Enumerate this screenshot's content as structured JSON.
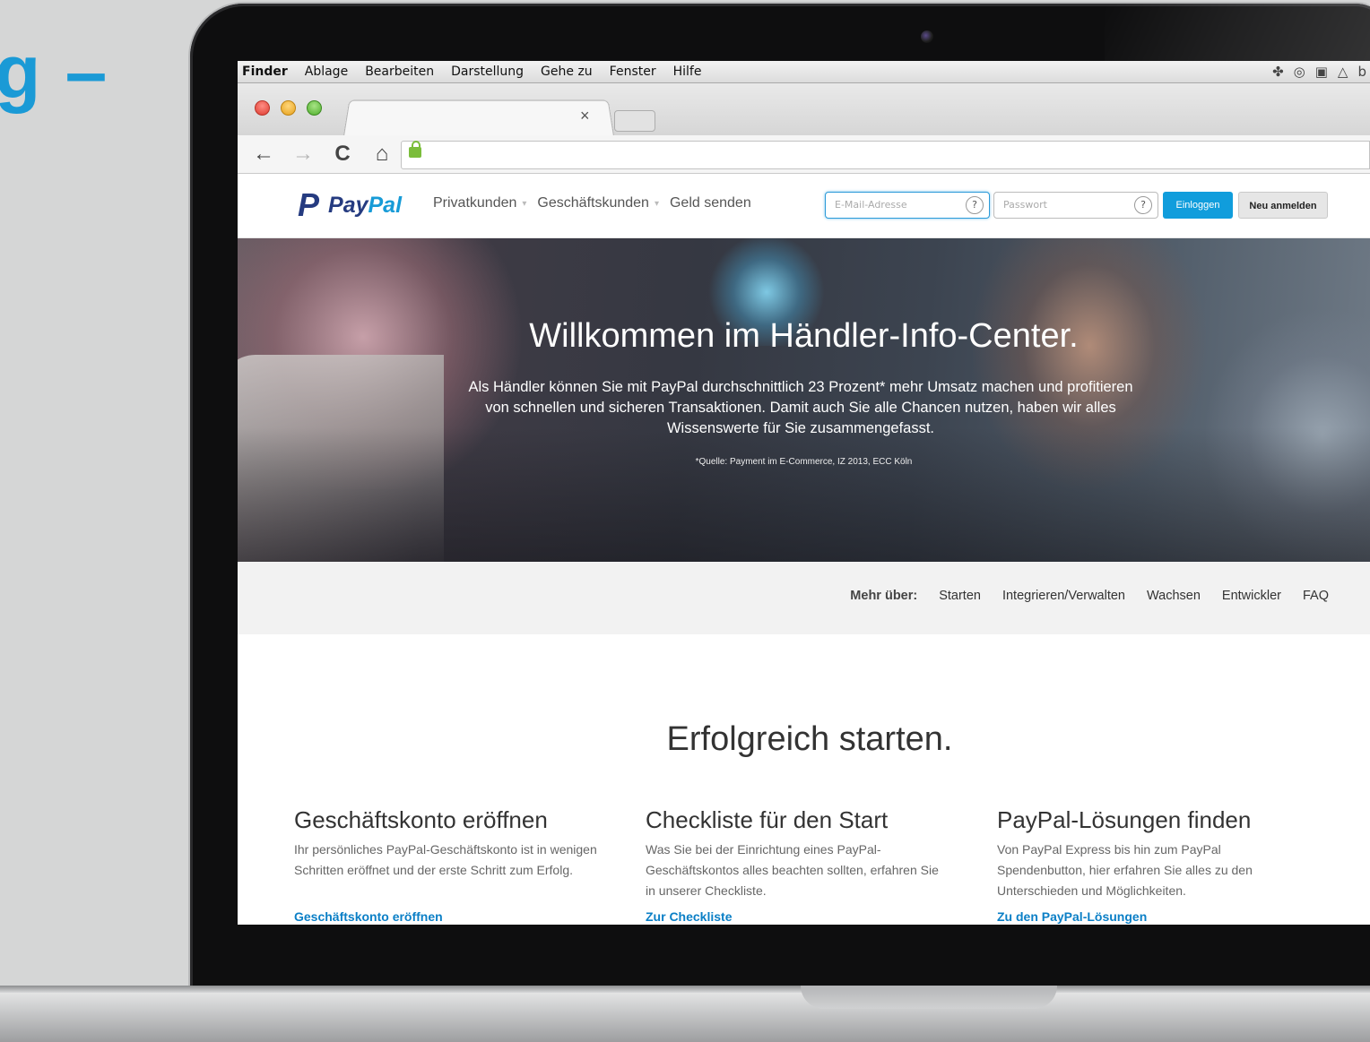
{
  "page": {
    "left_heading": "g –"
  },
  "menubar": {
    "items": [
      "Finder",
      "Ablage",
      "Bearbeiten",
      "Darstellung",
      "Gehe zu",
      "Fenster",
      "Hilfe"
    ],
    "tray_icons": [
      "dropbox-icon",
      "creative-cloud-icon",
      "evernote-icon",
      "google-drive-icon"
    ],
    "tray_text": "b"
  },
  "browser": {
    "tab_close": "×",
    "nav_icons": {
      "back": "←",
      "forward": "→",
      "reload": "C",
      "home": "⌂"
    }
  },
  "paypal_header": {
    "logo_mark": "P",
    "logo_pay": "Pay",
    "logo_pal": "Pal",
    "nav": [
      "Privatkunden",
      "Geschäftskunden",
      "Geld senden"
    ],
    "email_placeholder": "E-Mail-Adresse",
    "password_placeholder": "Passwort",
    "help_glyph": "?",
    "login_button": "Einloggen",
    "signup_button": "Neu anmelden"
  },
  "hero": {
    "title": "Willkommen im Händler-Info-Center.",
    "text_line1": "Als Händler können Sie mit PayPal durchschnittlich 23 Prozent* mehr Umsatz machen und profitieren",
    "text_line2": "von schnellen und sicheren Transaktionen. Damit auch Sie alle Chancen nutzen, haben wir alles",
    "text_line3": "Wissenswerte für Sie zusammengefasst.",
    "note": "*Quelle: Payment im E-Commerce, IZ 2013, ECC Köln"
  },
  "subnav": {
    "label": "Mehr über:",
    "items": [
      "Starten",
      "Integrieren/Verwalten",
      "Wachsen",
      "Entwickler",
      "FAQ"
    ]
  },
  "content": {
    "title": "Erfolgreich starten.",
    "columns": [
      {
        "heading": "Geschäftskonto eröffnen",
        "text": "Ihr persönliches PayPal-Geschäftskonto ist in wenigen Schritten eröffnet und der erste Schritt zum Erfolg.",
        "link": "Geschäftskonto eröffnen"
      },
      {
        "heading": "Checkliste für den Start",
        "text": "Was Sie bei der Einrichtung eines PayPal-Geschäftskontos alles beachten sollten, erfahren Sie in unserer Checkliste.",
        "link": "Zur Checkliste"
      },
      {
        "heading": "PayPal-Lösungen finden",
        "text": "Von PayPal Express bis hin zum PayPal Spendenbutton, hier erfahren Sie alles zu den Unterschieden und Möglichkeiten.",
        "link": "Zu den PayPal-Lösungen"
      }
    ]
  }
}
